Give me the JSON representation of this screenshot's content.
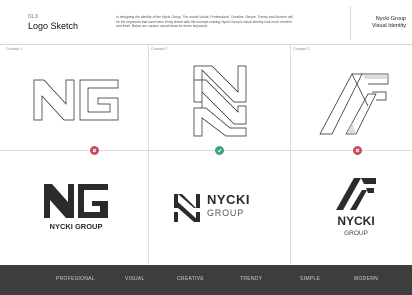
{
  "header": {
    "section_number": "01.3",
    "title": "Logo Sketch",
    "intro": "In designing the identity of the Nycki Group, The words Visual, Professional, Creative, Simple, Trendy and Modern will be the keywords that have been firmly linked with the concept making Nycki Group's visual identity look more modern and fresh. Below are various visual ideas for these keywords.",
    "brand_line1": "Nycki Group",
    "brand_line2": "Visual Identity"
  },
  "concepts": [
    {
      "label": "Concept 1",
      "status": "rejected",
      "logo_text": "NYCKI GROUP"
    },
    {
      "label": "Concept 2",
      "status": "approved",
      "logo_text_line1": "NYCKI",
      "logo_text_line2": "GROUP"
    },
    {
      "label": "Concept 3",
      "status": "rejected",
      "logo_text_line1": "NYCKI",
      "logo_text_line2": "GROUP"
    }
  ],
  "colors": {
    "reject": "#c94a5a",
    "approve": "#3aa579",
    "footer_bg": "#3d3d3d"
  },
  "keywords": [
    "PROFESIONAL",
    "VISUAL",
    "CREATIVE",
    "TRENDY",
    "SIMPLE",
    "MODERN"
  ]
}
